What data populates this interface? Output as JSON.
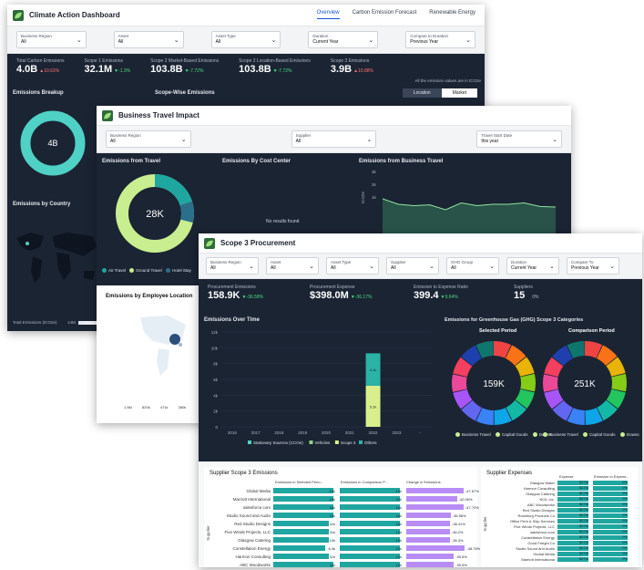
{
  "w1": {
    "title": "Climate Action Dashboard",
    "tabs": [
      "Overview",
      "Carbon Emission Forecast",
      "Renewable Energy"
    ],
    "filters": [
      {
        "label": "Business Region",
        "value": "All"
      },
      {
        "label": "Asset",
        "value": "All"
      },
      {
        "label": "Asset Type",
        "value": "All"
      },
      {
        "label": "Duration",
        "value": "Current Year"
      },
      {
        "label": "Compare to Duration",
        "value": "Previous Year"
      }
    ],
    "kpis": [
      {
        "label": "Total Carbon Emissions",
        "value": "4.0B",
        "delta": "▲10.63%",
        "dir": "up"
      },
      {
        "label": "Scope 1 Emissions",
        "value": "32.1M",
        "delta": "▼-1.3%",
        "dir": "down"
      },
      {
        "label": "Scope 2 Market-Based Emissions",
        "value": "103.8B",
        "delta": "▼-7.72%",
        "dir": "down"
      },
      {
        "label": "Scope 2 Location-Based Emissions",
        "value": "103.8B",
        "delta": "▼-7.72%",
        "dir": "down"
      },
      {
        "label": "Scope 3 Emissions",
        "value": "3.9B",
        "delta": "▲10.88%",
        "dir": "up"
      }
    ],
    "note": "All the emission values are in tCO2e",
    "breakdown_title": "Emissions Breakup",
    "scope_title": "Scope-Wise Emissions",
    "scope_toggle": [
      "Location",
      "Market"
    ],
    "donut_value": "4B",
    "country_title": "Emissions by Country",
    "map_legend_label": "Total Emissions (tCO2e)",
    "map_legend_min": "14M"
  },
  "w2": {
    "title": "Business Travel Impact",
    "filters": [
      {
        "label": "Business Region",
        "value": "All"
      },
      {
        "label": "Supplier",
        "value": "All"
      },
      {
        "label": "Travel Start Date",
        "value": "this year"
      }
    ],
    "travel_title": "Emissions from Travel",
    "donut_value": "28K",
    "legend": [
      "Air Travel",
      "Ground Travel",
      "Hotel Stay"
    ],
    "cost_center_title": "Emissions By Cost Center",
    "no_results": "No results found",
    "business_travel_title": "Emissions from Business Travel",
    "ylabel": "tCO2e",
    "yticks": [
      "3k",
      "2k",
      "1k"
    ],
    "employee_title": "Emissions by Employee Location",
    "bubble_legend": [
      "1.5M",
      "820k",
      "471k",
      "280k"
    ]
  },
  "w3": {
    "title": "Scope 3 Procurement",
    "filters": [
      {
        "label": "Business Region",
        "value": "All"
      },
      {
        "label": "Asset",
        "value": "All"
      },
      {
        "label": "Asset Type",
        "value": "All"
      },
      {
        "label": "Supplier",
        "value": "All"
      },
      {
        "label": "GHG Group",
        "value": "All"
      },
      {
        "label": "Duration",
        "value": "Current Year"
      },
      {
        "label": "Compare To",
        "value": "Previous Year"
      }
    ],
    "kpis": [
      {
        "label": "Procurement Emissions",
        "value": "158.9K",
        "delta": "▼-36.58%",
        "dir": "down"
      },
      {
        "label": "Procurement Expense",
        "value": "$398.0M",
        "delta": "▼-36.17%",
        "dir": "down"
      },
      {
        "label": "Emission to Expense Ratio",
        "value": "399.4",
        "delta": "▼9.64%",
        "dir": "down"
      },
      {
        "label": "Suppliers",
        "value": "15",
        "delta": "0%",
        "dir": "flat"
      }
    ],
    "over_time_title": "Emissions Over Time",
    "ghg_title": "Emissions for Greenhouse Gas (GHG) Scope 3 Categories",
    "selected_label": "Selected Period",
    "comparison_label": "Comparison Period",
    "selected_value": "159K",
    "comparison_value": "251K",
    "donut_legend": [
      "Business Travel",
      "Capital Goods",
      "Downs"
    ],
    "supplier_title": "Supplier Scope 3 Emissions",
    "supplier_cols": [
      "Emissions in Selected Perio...",
      "Emissions in Comparison P...",
      "Change in Emissions"
    ],
    "supplier_axis": "Supplier",
    "expenses_title": "Supplier Expenses",
    "expenses_cols": [
      "Expense",
      "Emission to Expens..."
    ],
    "expenses_axis": "Supplier"
  },
  "chart_data": [
    {
      "type": "bar",
      "title": "Emissions Over Time",
      "categories": [
        "2016",
        "2017",
        "2018",
        "2019",
        "2020",
        "2021",
        "2022",
        "2023",
        "-"
      ],
      "yticks": [
        "12k",
        "10k",
        "8k",
        "6k",
        "4k",
        "2k",
        "0"
      ],
      "ylim": [
        0,
        12
      ],
      "series": [
        {
          "name": "Stationary Sources (CCOe)",
          "color": "#4fd1c5",
          "values": [
            0,
            0,
            0,
            0,
            0,
            0,
            0,
            0,
            0
          ]
        },
        {
          "name": "Vehicles",
          "color": "#8fd18a",
          "values": [
            0,
            0,
            0,
            0,
            0,
            0,
            0,
            0,
            0
          ]
        },
        {
          "name": "Scope 3",
          "color": "#d9ef8b",
          "values": [
            0,
            0,
            0,
            0,
            0,
            0,
            5.2,
            0,
            0
          ]
        },
        {
          "name": "Others",
          "color": "#2ab3a6",
          "values": [
            0,
            0,
            0,
            0,
            0,
            0,
            4.1,
            0,
            0
          ]
        }
      ],
      "data_labels": [
        "5.2k",
        "4.1k"
      ]
    },
    {
      "type": "line",
      "title": "Emissions from Business Travel",
      "ylabel": "tCO2e",
      "ylim": [
        0,
        3
      ],
      "values": [
        2.0,
        1.8,
        1.75,
        1.78,
        1.6,
        1.85,
        1.75,
        1.8,
        1.8,
        1.85,
        1.72,
        1.7
      ]
    },
    {
      "type": "bar",
      "title": "Supplier Scope 3 Emissions",
      "categories": [
        "Global Media",
        "Marriott International",
        "salesforce.com",
        "Studio Sound and Audio",
        "Red Studio Designs",
        "Five Winds Projects, LLC",
        "Glasgow Catering",
        "Constellation Energy",
        "Harmon Consulting",
        "ABC Woodworks"
      ],
      "series": [
        {
          "name": "Emissions in Selected Perio...",
          "values": [
            14,
            14,
            14,
            14,
            13,
            13,
            13,
            12,
            13,
            14
          ],
          "labels": [
            "19k",
            "19k",
            "16k",
            "15k",
            "11k",
            "11k",
            "10k",
            "6.4k",
            "11k",
            "11k"
          ]
        },
        {
          "name": "Emissions in Comparison P...",
          "values": [
            14,
            14,
            14,
            14,
            14,
            14,
            14,
            14,
            14,
            14
          ],
          "labels": [
            "19k",
            "19k",
            "16k",
            "18k",
            "18k",
            "19k",
            "19k",
            "19k",
            "19k",
            "19k"
          ]
        },
        {
          "name": "Change in Emissions",
          "values": [
            -47.67,
            -42.06,
            -47.7,
            -36.98,
            -36.41,
            -36.2,
            -36.3,
            -48.75,
            -39.5,
            -39.5
          ],
          "labels": [
            "-47.67%",
            "-42.06%",
            "-47.70%",
            "-36.98%",
            "-36.41%",
            "-36.2%",
            "-36.3%",
            "-48.75%",
            "-39.5%",
            "-39.5%"
          ]
        }
      ]
    },
    {
      "type": "bar",
      "title": "Supplier Expenses",
      "categories": [
        "Glasgow Water",
        "Harmon Consulting",
        "Glasgow Catering",
        "NCIL Inc.",
        "ABC Woodworks",
        "Red Studio Designs",
        "Roseburg Products Co",
        "Office Print & Ship Services",
        "Five Winds Projects, LLC",
        "salesforce.com",
        "Constellation Energy",
        "Good Freight Co",
        "Studio Sound and Audio",
        "Global Media",
        "Marriott International"
      ],
      "series": [
        {
          "name": "Expense",
          "values": [
            1,
            1,
            1,
            1,
            1,
            1,
            1,
            1,
            1,
            1,
            1,
            1,
            1,
            1,
            1
          ],
          "labels": [
            "$27M",
            "$27M",
            "$27M",
            "$27M",
            "$27M",
            "$27M",
            "$27M",
            "$27M",
            "$27M",
            "$27M",
            "$27M",
            "$27M",
            "$27M",
            "$27M",
            "$27M"
          ]
        },
        {
          "name": "Emission to Expens...",
          "values": [
            1,
            1,
            1,
            1,
            1,
            1,
            1,
            1,
            1,
            1,
            1,
            1,
            1,
            1,
            1
          ],
          "labels": [
            "0%",
            "0%",
            "0%",
            "0%",
            "0%",
            "0%",
            "0%",
            "0%",
            "0%",
            "0%",
            "0%",
            "0%",
            "0%",
            "0%",
            "0%"
          ]
        }
      ]
    }
  ],
  "colors": {
    "dark_bg": "#1b2433",
    "teal": "#1fa6a0",
    "lime": "#c8ee8f",
    "purple": "#b88cf5",
    "accent": "#1a56db"
  }
}
